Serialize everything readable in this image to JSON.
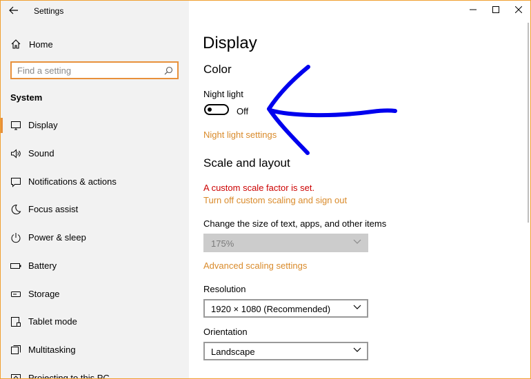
{
  "window": {
    "title": "Settings"
  },
  "sidebar": {
    "home_label": "Home",
    "search_placeholder": "Find a setting",
    "section_label": "System",
    "items": [
      {
        "label": "Display",
        "icon": "monitor-icon",
        "active": true
      },
      {
        "label": "Sound",
        "icon": "speaker-icon"
      },
      {
        "label": "Notifications & actions",
        "icon": "notification-icon"
      },
      {
        "label": "Focus assist",
        "icon": "moon-icon"
      },
      {
        "label": "Power & sleep",
        "icon": "power-icon"
      },
      {
        "label": "Battery",
        "icon": "battery-icon"
      },
      {
        "label": "Storage",
        "icon": "storage-icon"
      },
      {
        "label": "Tablet mode",
        "icon": "tablet-icon"
      },
      {
        "label": "Multitasking",
        "icon": "multitasking-icon"
      },
      {
        "label": "Projecting to this PC",
        "icon": "projecting-icon"
      }
    ]
  },
  "main": {
    "page_title": "Display",
    "color_heading": "Color",
    "night_light_label": "Night light",
    "night_light_state": "Off",
    "night_light_settings_link": "Night light settings",
    "scale_heading": "Scale and layout",
    "custom_scale_warning": "A custom scale factor is set.",
    "turn_off_scaling_link": "Turn off custom scaling and sign out",
    "text_size_label": "Change the size of text, apps, and other items",
    "text_size_value": "175%",
    "advanced_scaling_link": "Advanced scaling settings",
    "resolution_label": "Resolution",
    "resolution_value": "1920 × 1080 (Recommended)",
    "orientation_label": "Orientation",
    "orientation_value": "Landscape"
  },
  "colors": {
    "accent": "#e8903a",
    "link": "#d98a2a",
    "warning": "#cc0000",
    "annotation": "#0000ee"
  }
}
